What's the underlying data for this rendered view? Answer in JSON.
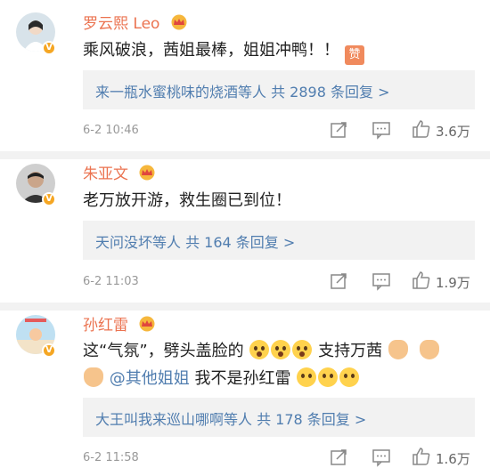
{
  "comments": [
    {
      "username": "罗云熙 Leo",
      "text": "乘风破浪，茜姐最棒，姐姐冲鸭！！",
      "sticker_label": "赞",
      "reply_summary": "来一瓶水蜜桃味的烧酒等人 共 2898 条回复 >",
      "time": "6-2 10:46",
      "likes": "3.6万"
    },
    {
      "username": "朱亚文",
      "text": "老万放开游，救生圈已到位！",
      "reply_summary": "天问没坏等人 共 164 条回复 >",
      "time": "6-2 11:03",
      "likes": "1.9万"
    },
    {
      "username": "孙红雷",
      "text_line1_a": "这“气氛”，劈头盖脸的",
      "text_line1_b": "支持万茜",
      "mention": "@其他姐姐",
      "text_line2": "我不是孙红雷",
      "reply_summary": "大王叫我来巡山哪啊等人 共 178 条回复 >",
      "time": "6-2 11:58",
      "likes": "1.6万"
    }
  ],
  "colors": {
    "username": "#eb7350",
    "link": "#507daf",
    "reply_bg": "#f2f2f2",
    "meta": "#999999",
    "badge": "#f5a623"
  },
  "icons": [
    "verified-badge",
    "crown-icon",
    "share-icon",
    "comment-icon",
    "like-icon"
  ]
}
